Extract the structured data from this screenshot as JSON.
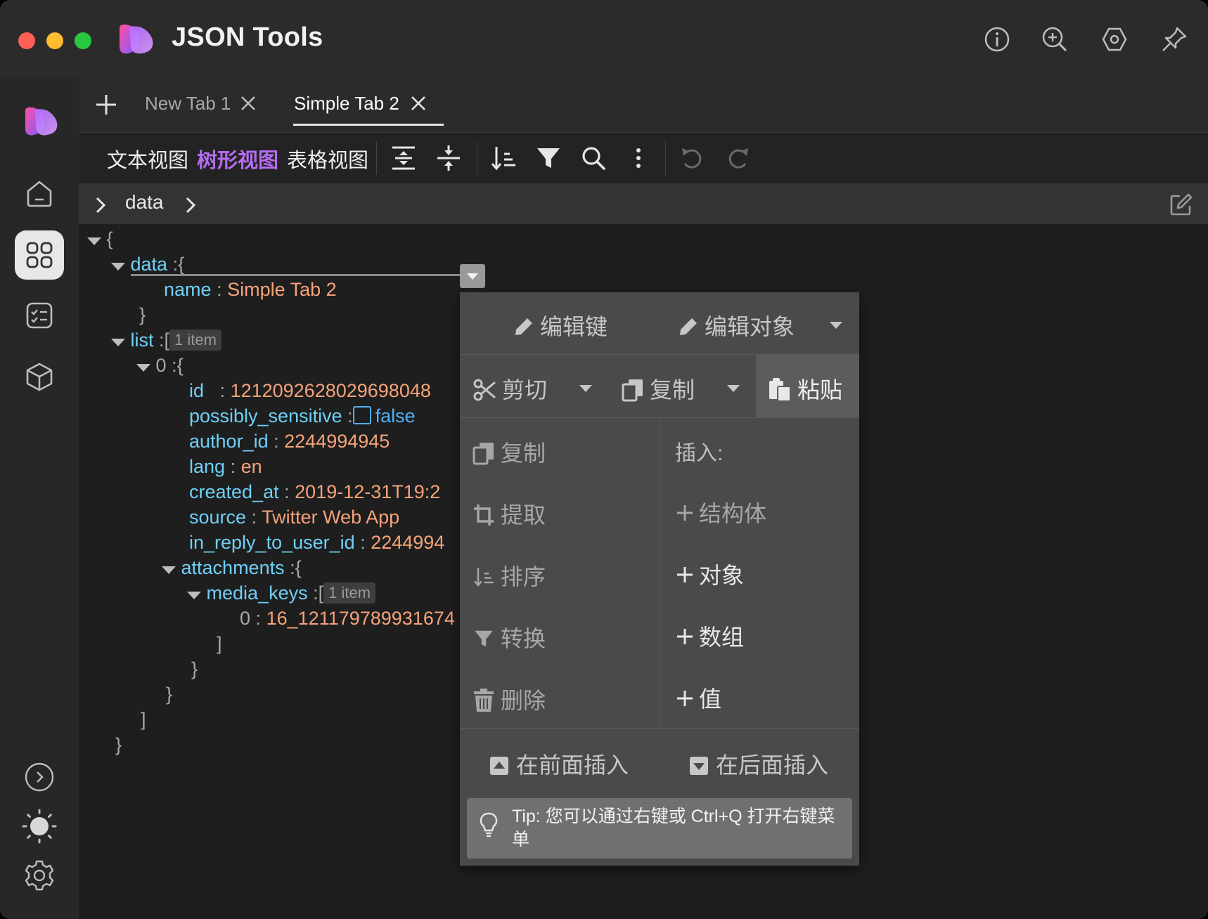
{
  "app": {
    "title": "JSON Tools"
  },
  "colors": {
    "accent": "#b56cf0",
    "key": "#6fd0f7",
    "value": "#f5a37a",
    "boolean": "#4fb0f2"
  },
  "titlebar": {
    "icons": [
      "info-icon",
      "zoom-in-icon",
      "hexagon-settings-icon",
      "pin-icon"
    ]
  },
  "sidebar": {
    "items": [
      "home-icon",
      "apps-grid-icon",
      "checklist-icon",
      "package-box-icon"
    ],
    "bottom": [
      "expand-chevron-icon",
      "theme-sun-icon",
      "settings-gear-icon"
    ]
  },
  "tabs": [
    {
      "label": "New Tab 1",
      "active": false
    },
    {
      "label": "Simple Tab 2",
      "active": true
    }
  ],
  "toolbar": {
    "views": [
      {
        "label": "文本视图",
        "active": false
      },
      {
        "label": "树形视图",
        "active": true
      },
      {
        "label": "表格视图",
        "active": false
      }
    ]
  },
  "breadcrumb": {
    "path": "data"
  },
  "tree": {
    "open_brace": "{",
    "close_brace": "}",
    "data_key": "data",
    "name_key": "name",
    "name_value": "Simple Tab 2",
    "list_key": "list",
    "list_badge": "1 item",
    "item_index": "0",
    "id_key": "id",
    "id_value": "1212092628029698048",
    "ps_key": "possibly_sensitive",
    "ps_value": "false",
    "author_key": "author_id",
    "author_value": "2244994945",
    "lang_key": "lang",
    "lang_value": "en",
    "created_key": "created_at",
    "created_value": "2019-12-31T19:2",
    "source_key": "source",
    "source_value": "Twitter Web App",
    "reply_key": "in_reply_to_user_id",
    "reply_value": "2244994",
    "attach_key": "attachments",
    "media_key": "media_keys",
    "media_badge": "1 item",
    "media_index": "0",
    "media_value": "16_121179789931674",
    "colon_brace": ":{",
    "colon_bracket": ":[",
    "colon": ":",
    "close_bracket": "]"
  },
  "context_menu": {
    "edit_key": "编辑键",
    "edit_object": "编辑对象",
    "cut": "剪切",
    "copy_fmt": "复制",
    "paste": "粘贴",
    "duplicate": "复制",
    "extract": "提取",
    "sort": "排序",
    "transform": "转换",
    "delete": "删除",
    "insert_header": "插入:",
    "insert_struct": "结构体",
    "insert_object": "对象",
    "insert_array": "数组",
    "insert_value": "值",
    "insert_before": "在前面插入",
    "insert_after": "在后面插入",
    "tip": "Tip: 您可以通过右键或 Ctrl+Q 打开右键菜单"
  }
}
